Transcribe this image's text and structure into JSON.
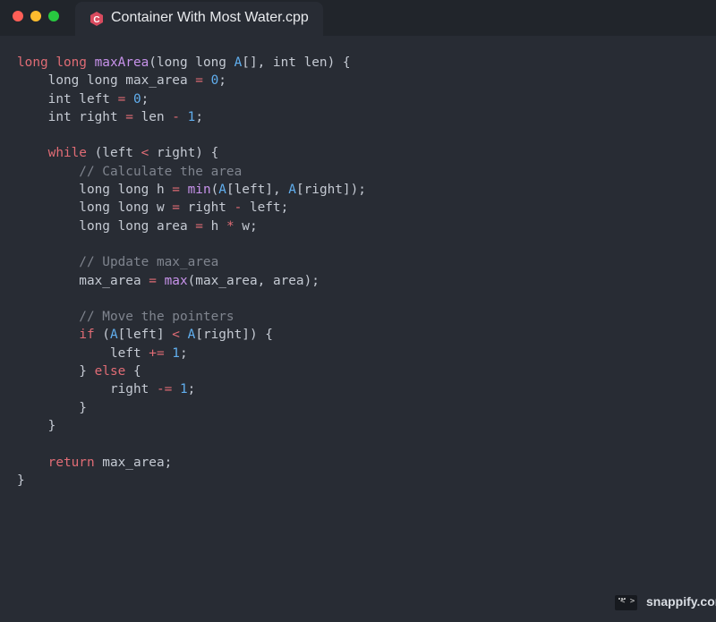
{
  "window": {
    "title": "Container With Most Water.cpp",
    "file_icon": "cpp-icon"
  },
  "code_lines": [
    [
      {
        "text": "long long ",
        "class": "kw"
      },
      {
        "text": "maxArea",
        "class": "fn"
      },
      {
        "text": "(long long ",
        "class": "plain"
      },
      {
        "text": "A",
        "class": "id"
      },
      {
        "text": "[], int len) {",
        "class": "plain"
      }
    ],
    [
      {
        "text": "    long long max_area ",
        "class": "plain"
      },
      {
        "text": "=",
        "class": "op"
      },
      {
        "text": " ",
        "class": "plain"
      },
      {
        "text": "0",
        "class": "num"
      },
      {
        "text": ";",
        "class": "plain"
      }
    ],
    [
      {
        "text": "    int left ",
        "class": "plain"
      },
      {
        "text": "=",
        "class": "op"
      },
      {
        "text": " ",
        "class": "plain"
      },
      {
        "text": "0",
        "class": "num"
      },
      {
        "text": ";",
        "class": "plain"
      }
    ],
    [
      {
        "text": "    int right ",
        "class": "plain"
      },
      {
        "text": "=",
        "class": "op"
      },
      {
        "text": " len ",
        "class": "plain"
      },
      {
        "text": "-",
        "class": "op"
      },
      {
        "text": " ",
        "class": "plain"
      },
      {
        "text": "1",
        "class": "num"
      },
      {
        "text": ";",
        "class": "plain"
      }
    ],
    [
      {
        "text": "",
        "class": "plain"
      }
    ],
    [
      {
        "text": "    ",
        "class": "plain"
      },
      {
        "text": "while",
        "class": "kw"
      },
      {
        "text": " (left ",
        "class": "plain"
      },
      {
        "text": "<",
        "class": "op"
      },
      {
        "text": " right) {",
        "class": "plain"
      }
    ],
    [
      {
        "text": "        // Calculate the area",
        "class": "cm"
      }
    ],
    [
      {
        "text": "        long long h ",
        "class": "plain"
      },
      {
        "text": "=",
        "class": "op"
      },
      {
        "text": " ",
        "class": "plain"
      },
      {
        "text": "min",
        "class": "fn"
      },
      {
        "text": "(",
        "class": "plain"
      },
      {
        "text": "A",
        "class": "id"
      },
      {
        "text": "[left], ",
        "class": "plain"
      },
      {
        "text": "A",
        "class": "id"
      },
      {
        "text": "[right]);",
        "class": "plain"
      }
    ],
    [
      {
        "text": "        long long w ",
        "class": "plain"
      },
      {
        "text": "=",
        "class": "op"
      },
      {
        "text": " right ",
        "class": "plain"
      },
      {
        "text": "-",
        "class": "op"
      },
      {
        "text": " left;",
        "class": "plain"
      }
    ],
    [
      {
        "text": "        long long area ",
        "class": "plain"
      },
      {
        "text": "=",
        "class": "op"
      },
      {
        "text": " h ",
        "class": "plain"
      },
      {
        "text": "*",
        "class": "op"
      },
      {
        "text": " w;",
        "class": "plain"
      }
    ],
    [
      {
        "text": "",
        "class": "plain"
      }
    ],
    [
      {
        "text": "        // Update max_area",
        "class": "cm"
      }
    ],
    [
      {
        "text": "        max_area ",
        "class": "plain"
      },
      {
        "text": "=",
        "class": "op"
      },
      {
        "text": " ",
        "class": "plain"
      },
      {
        "text": "max",
        "class": "fn"
      },
      {
        "text": "(max_area, area);",
        "class": "plain"
      }
    ],
    [
      {
        "text": "",
        "class": "plain"
      }
    ],
    [
      {
        "text": "        // Move the pointers",
        "class": "cm"
      }
    ],
    [
      {
        "text": "        ",
        "class": "plain"
      },
      {
        "text": "if",
        "class": "kw"
      },
      {
        "text": " (",
        "class": "plain"
      },
      {
        "text": "A",
        "class": "id"
      },
      {
        "text": "[left] ",
        "class": "plain"
      },
      {
        "text": "<",
        "class": "op"
      },
      {
        "text": " ",
        "class": "plain"
      },
      {
        "text": "A",
        "class": "id"
      },
      {
        "text": "[right]) {",
        "class": "plain"
      }
    ],
    [
      {
        "text": "            left ",
        "class": "plain"
      },
      {
        "text": "+=",
        "class": "op"
      },
      {
        "text": " ",
        "class": "plain"
      },
      {
        "text": "1",
        "class": "num"
      },
      {
        "text": ";",
        "class": "plain"
      }
    ],
    [
      {
        "text": "        } ",
        "class": "plain"
      },
      {
        "text": "else",
        "class": "kw"
      },
      {
        "text": " {",
        "class": "plain"
      }
    ],
    [
      {
        "text": "            right ",
        "class": "plain"
      },
      {
        "text": "-=",
        "class": "op"
      },
      {
        "text": " ",
        "class": "plain"
      },
      {
        "text": "1",
        "class": "num"
      },
      {
        "text": ";",
        "class": "plain"
      }
    ],
    [
      {
        "text": "        }",
        "class": "plain"
      }
    ],
    [
      {
        "text": "    }",
        "class": "plain"
      }
    ],
    [
      {
        "text": "",
        "class": "plain"
      }
    ],
    [
      {
        "text": "    ",
        "class": "plain"
      },
      {
        "text": "return",
        "class": "kw"
      },
      {
        "text": " max_area;",
        "class": "plain"
      }
    ],
    [
      {
        "text": "}",
        "class": "plain"
      }
    ]
  ],
  "watermark": {
    "symbol": "< >",
    "text": "snappify.com",
    "icon": "code-brackets-icon"
  },
  "colors": {
    "background": "#282c34",
    "titlebar": "#21252b",
    "keyword": "#e06c75",
    "function": "#c792ea",
    "number": "#61afef",
    "comment": "#7f848e",
    "text": "#c5cad3"
  }
}
